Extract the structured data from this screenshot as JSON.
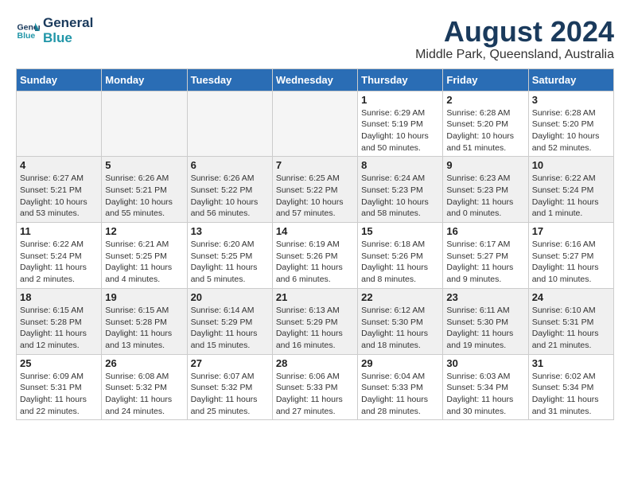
{
  "header": {
    "logo_line1": "General",
    "logo_line2": "Blue",
    "month_year": "August 2024",
    "location": "Middle Park, Queensland, Australia"
  },
  "weekdays": [
    "Sunday",
    "Monday",
    "Tuesday",
    "Wednesday",
    "Thursday",
    "Friday",
    "Saturday"
  ],
  "weeks": [
    [
      {
        "day": "",
        "empty": true
      },
      {
        "day": "",
        "empty": true
      },
      {
        "day": "",
        "empty": true
      },
      {
        "day": "",
        "empty": true
      },
      {
        "day": "1",
        "sunrise": "6:29 AM",
        "sunset": "5:19 PM",
        "daylight": "10 hours and 50 minutes."
      },
      {
        "day": "2",
        "sunrise": "6:28 AM",
        "sunset": "5:20 PM",
        "daylight": "10 hours and 51 minutes."
      },
      {
        "day": "3",
        "sunrise": "6:28 AM",
        "sunset": "5:20 PM",
        "daylight": "10 hours and 52 minutes."
      }
    ],
    [
      {
        "day": "4",
        "sunrise": "6:27 AM",
        "sunset": "5:21 PM",
        "daylight": "10 hours and 53 minutes."
      },
      {
        "day": "5",
        "sunrise": "6:26 AM",
        "sunset": "5:21 PM",
        "daylight": "10 hours and 55 minutes."
      },
      {
        "day": "6",
        "sunrise": "6:26 AM",
        "sunset": "5:22 PM",
        "daylight": "10 hours and 56 minutes."
      },
      {
        "day": "7",
        "sunrise": "6:25 AM",
        "sunset": "5:22 PM",
        "daylight": "10 hours and 57 minutes."
      },
      {
        "day": "8",
        "sunrise": "6:24 AM",
        "sunset": "5:23 PM",
        "daylight": "10 hours and 58 minutes."
      },
      {
        "day": "9",
        "sunrise": "6:23 AM",
        "sunset": "5:23 PM",
        "daylight": "11 hours and 0 minutes."
      },
      {
        "day": "10",
        "sunrise": "6:22 AM",
        "sunset": "5:24 PM",
        "daylight": "11 hours and 1 minute."
      }
    ],
    [
      {
        "day": "11",
        "sunrise": "6:22 AM",
        "sunset": "5:24 PM",
        "daylight": "11 hours and 2 minutes."
      },
      {
        "day": "12",
        "sunrise": "6:21 AM",
        "sunset": "5:25 PM",
        "daylight": "11 hours and 4 minutes."
      },
      {
        "day": "13",
        "sunrise": "6:20 AM",
        "sunset": "5:25 PM",
        "daylight": "11 hours and 5 minutes."
      },
      {
        "day": "14",
        "sunrise": "6:19 AM",
        "sunset": "5:26 PM",
        "daylight": "11 hours and 6 minutes."
      },
      {
        "day": "15",
        "sunrise": "6:18 AM",
        "sunset": "5:26 PM",
        "daylight": "11 hours and 8 minutes."
      },
      {
        "day": "16",
        "sunrise": "6:17 AM",
        "sunset": "5:27 PM",
        "daylight": "11 hours and 9 minutes."
      },
      {
        "day": "17",
        "sunrise": "6:16 AM",
        "sunset": "5:27 PM",
        "daylight": "11 hours and 10 minutes."
      }
    ],
    [
      {
        "day": "18",
        "sunrise": "6:15 AM",
        "sunset": "5:28 PM",
        "daylight": "11 hours and 12 minutes."
      },
      {
        "day": "19",
        "sunrise": "6:15 AM",
        "sunset": "5:28 PM",
        "daylight": "11 hours and 13 minutes."
      },
      {
        "day": "20",
        "sunrise": "6:14 AM",
        "sunset": "5:29 PM",
        "daylight": "11 hours and 15 minutes."
      },
      {
        "day": "21",
        "sunrise": "6:13 AM",
        "sunset": "5:29 PM",
        "daylight": "11 hours and 16 minutes."
      },
      {
        "day": "22",
        "sunrise": "6:12 AM",
        "sunset": "5:30 PM",
        "daylight": "11 hours and 18 minutes."
      },
      {
        "day": "23",
        "sunrise": "6:11 AM",
        "sunset": "5:30 PM",
        "daylight": "11 hours and 19 minutes."
      },
      {
        "day": "24",
        "sunrise": "6:10 AM",
        "sunset": "5:31 PM",
        "daylight": "11 hours and 21 minutes."
      }
    ],
    [
      {
        "day": "25",
        "sunrise": "6:09 AM",
        "sunset": "5:31 PM",
        "daylight": "11 hours and 22 minutes."
      },
      {
        "day": "26",
        "sunrise": "6:08 AM",
        "sunset": "5:32 PM",
        "daylight": "11 hours and 24 minutes."
      },
      {
        "day": "27",
        "sunrise": "6:07 AM",
        "sunset": "5:32 PM",
        "daylight": "11 hours and 25 minutes."
      },
      {
        "day": "28",
        "sunrise": "6:06 AM",
        "sunset": "5:33 PM",
        "daylight": "11 hours and 27 minutes."
      },
      {
        "day": "29",
        "sunrise": "6:04 AM",
        "sunset": "5:33 PM",
        "daylight": "11 hours and 28 minutes."
      },
      {
        "day": "30",
        "sunrise": "6:03 AM",
        "sunset": "5:34 PM",
        "daylight": "11 hours and 30 minutes."
      },
      {
        "day": "31",
        "sunrise": "6:02 AM",
        "sunset": "5:34 PM",
        "daylight": "11 hours and 31 minutes."
      }
    ]
  ],
  "labels": {
    "sunrise": "Sunrise:",
    "sunset": "Sunset:",
    "daylight": "Daylight:"
  }
}
